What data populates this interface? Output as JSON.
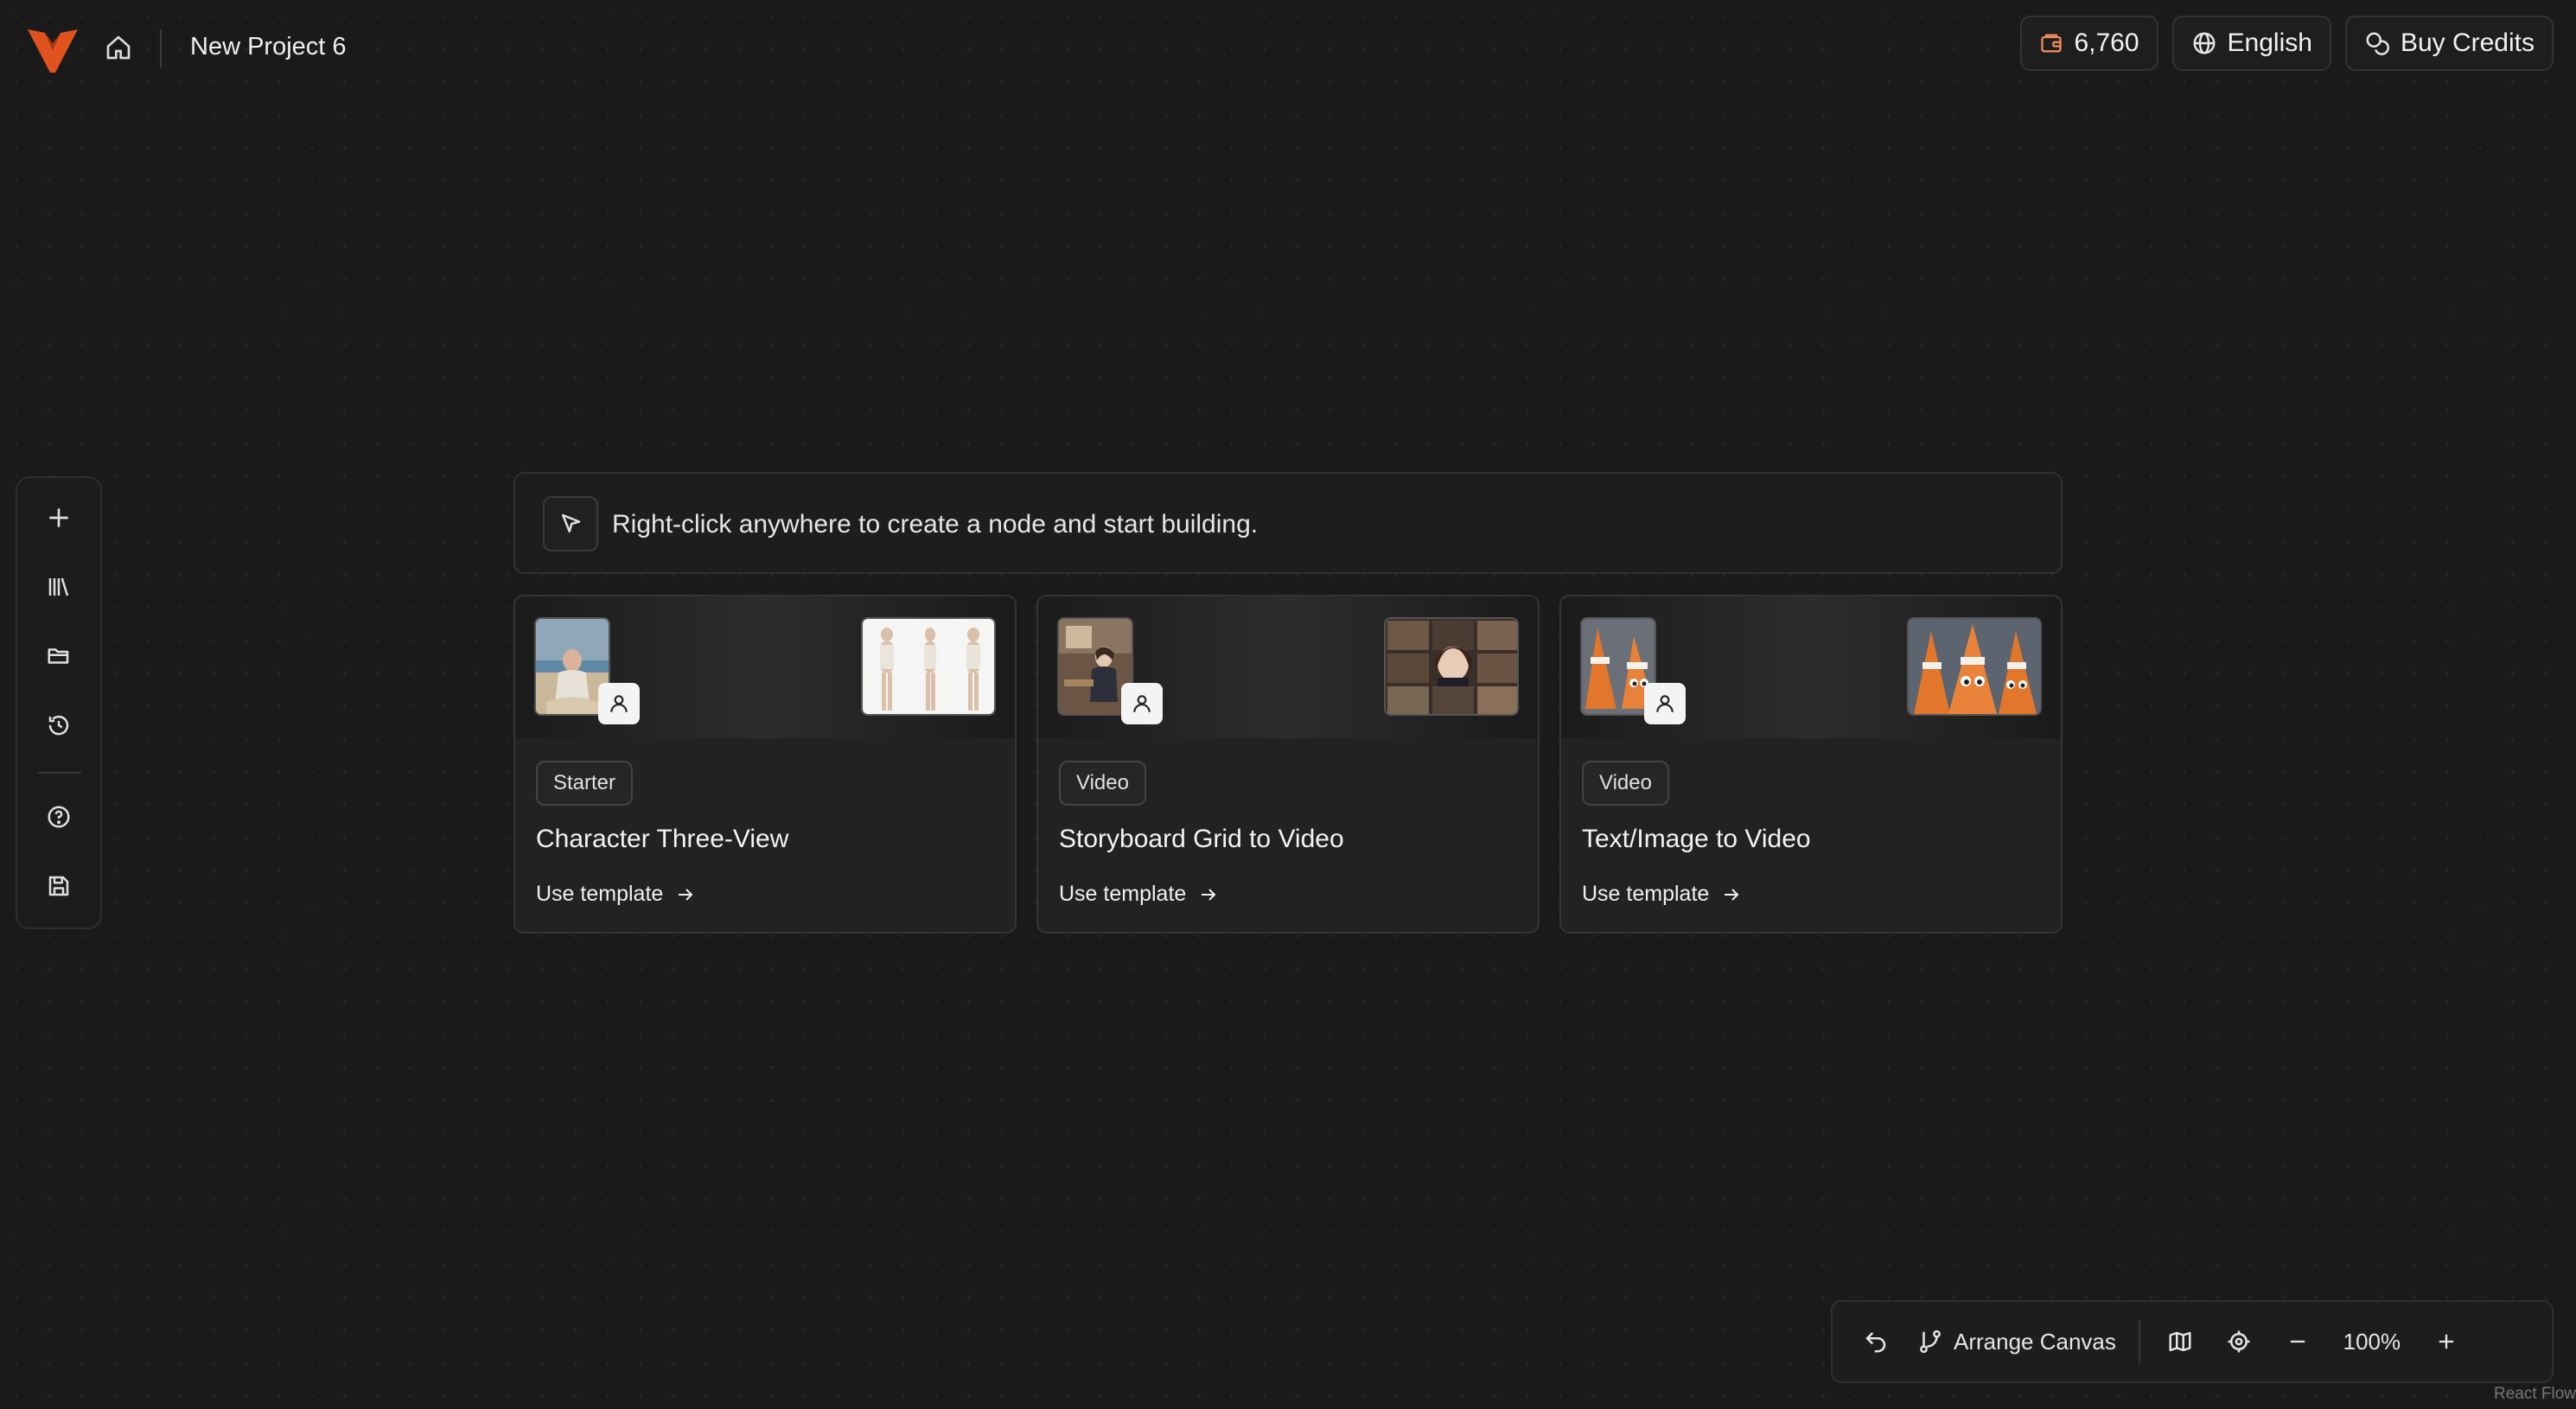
{
  "header": {
    "project_title": "New Project 6",
    "credits_value": "6,760",
    "language_label": "English",
    "buy_credits_label": "Buy Credits"
  },
  "sidebar": {
    "items": [
      {
        "name": "add",
        "icon": "plus-icon"
      },
      {
        "name": "library",
        "icon": "library-icon"
      },
      {
        "name": "folder",
        "icon": "folder-icon"
      },
      {
        "name": "history",
        "icon": "history-icon"
      },
      {
        "name": "help",
        "icon": "help-icon"
      },
      {
        "name": "save",
        "icon": "save-icon"
      }
    ]
  },
  "hint": {
    "text": "Right-click anywhere to create a node and start building."
  },
  "templates": [
    {
      "tag": "Starter",
      "title": "Character Three-View",
      "action": "Use template"
    },
    {
      "tag": "Video",
      "title": "Storyboard Grid to Video",
      "action": "Use template"
    },
    {
      "tag": "Video",
      "title": "Text/Image to Video",
      "action": "Use template"
    }
  ],
  "toolbar": {
    "arrange_label": "Arrange Canvas",
    "zoom_level": "100%"
  },
  "watermark": "React Flow",
  "colors": {
    "background": "#1a1a1a",
    "accent_logo": "#e0531f",
    "credits_icon": "#f08a5d"
  }
}
